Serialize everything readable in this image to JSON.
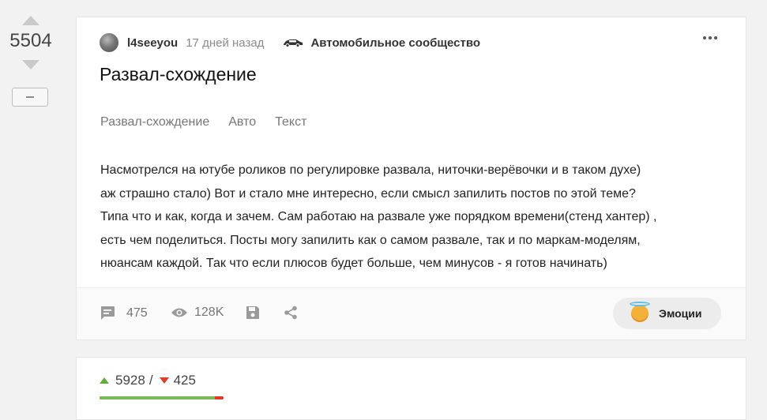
{
  "rating": {
    "score": "5504"
  },
  "post": {
    "author": "l4seeyou",
    "time": "17 дней назад",
    "community": "Автомобильное сообщество",
    "title": "Развал-схождение",
    "tags": [
      "Развал-схождение",
      "Авто",
      "Текст"
    ],
    "body_lines": [
      "Насмотрелся на ютубе роликов по регулировке развала, ниточки-верёвочки и в таком духе)",
      "аж страшно стало) Вот и стало мне интересно, если смысл запилить постов по этой теме?",
      "Типа что и как, когда и зачем. Сам работаю на развале уже порядком времени(стенд хантер) ,",
      "есть чем поделиться. Посты могу запилить как о самом развале, так и по маркам-моделям,",
      "нюансам каждой. Так что если плюсов будет больше, чем минусов - я готов начинать)"
    ],
    "comments": "475",
    "views": "128K",
    "emotions_label": "Эмоции"
  },
  "votes": {
    "plus": "5928",
    "separator": "/",
    "minus": "425",
    "plus_fraction": 0.933
  },
  "colors": {
    "plus": "#5fad3b",
    "minus": "#e0392b",
    "bar_plus": "#79b95a"
  },
  "icons": [
    "arrow-up-icon",
    "arrow-down-icon",
    "minus-icon",
    "avatar",
    "car-icon",
    "more-icon",
    "comment-icon",
    "eye-icon",
    "save-icon",
    "share-icon",
    "emotion-icon"
  ]
}
